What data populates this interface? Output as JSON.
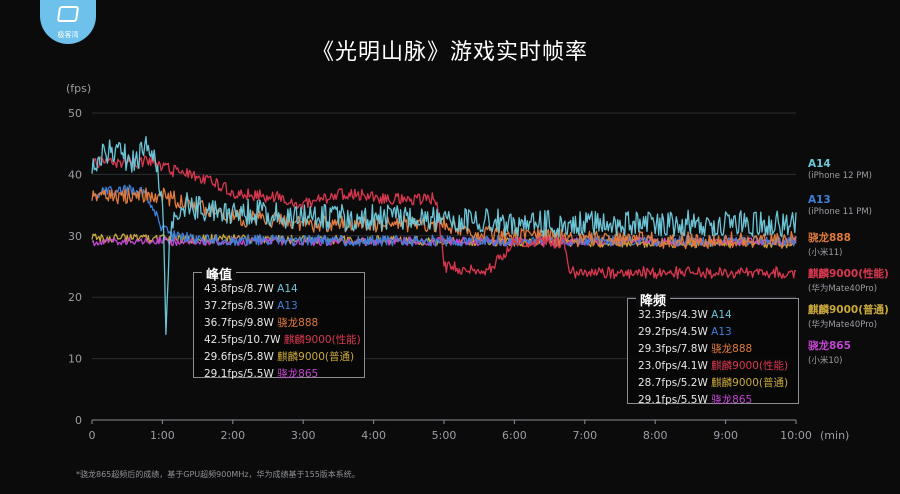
{
  "logo": {
    "text": "极客湾"
  },
  "title": "《光明山脉》游戏实时帧率",
  "chart_data": {
    "type": "line",
    "ylabel": "(fps)",
    "xunit": "(min)",
    "xlim": [
      0,
      10
    ],
    "ylim": [
      0,
      50
    ],
    "yticks": [
      0,
      10,
      20,
      30,
      40,
      50
    ],
    "xticks": [
      "0",
      "1:00",
      "2:00",
      "3:00",
      "4:00",
      "5:00",
      "6:00",
      "7:00",
      "8:00",
      "9:00",
      "10:00"
    ],
    "grid": true,
    "series": [
      {
        "name": "A14",
        "device": "(iPhone 12 PM)",
        "color": "#6cc5d6",
        "x": [
          0,
          0.3,
          0.6,
          0.85,
          1.0,
          1.05,
          1.1,
          1.3,
          2.0,
          3.0,
          4.0,
          5.0,
          6.0,
          7.0,
          8.0,
          9.0,
          10.0
        ],
        "values": [
          42,
          44,
          42,
          45,
          36,
          14,
          30,
          35,
          34,
          33,
          33,
          33,
          32,
          32,
          32,
          32,
          32
        ]
      },
      {
        "name": "A13",
        "device": "(iPhone 11 PM)",
        "color": "#3f7fd9",
        "x": [
          0,
          0.5,
          0.75,
          0.9,
          1.0,
          1.15,
          1.5,
          2.0,
          4.0,
          6.0,
          8.0,
          10.0
        ],
        "values": [
          37,
          37.5,
          37,
          34,
          31,
          30,
          29.5,
          29.3,
          29.2,
          29.2,
          29.2,
          29.2
        ]
      },
      {
        "name": "骁龙888",
        "device": "(小米11)",
        "color": "#e07a3d",
        "x": [
          0,
          1.0,
          1.5,
          2.0,
          3.0,
          4.0,
          5.0,
          5.5,
          6.0,
          7.0,
          8.0,
          9.0,
          10.0
        ],
        "values": [
          36.5,
          36.5,
          35,
          33,
          32,
          32,
          32,
          30.5,
          30,
          29.5,
          29.3,
          29.3,
          29.3
        ]
      },
      {
        "name": "麒麟9000(性能)",
        "device": "(华为Mate40Pro)",
        "color": "#d8384f",
        "x": [
          0,
          0.9,
          1.0,
          1.4,
          1.7,
          2.0,
          2.8,
          3.0,
          3.6,
          4.2,
          4.9,
          5.0,
          5.6,
          6.0,
          6.7,
          6.8,
          8.0,
          9.0,
          10.0
        ],
        "values": [
          42,
          42,
          41,
          40,
          39,
          37,
          36,
          35,
          37,
          36,
          36,
          25,
          24,
          29,
          29,
          24,
          24,
          24,
          24
        ]
      },
      {
        "name": "麒麟9000(普通)",
        "device": "(华为Mate40Pro)",
        "color": "#c9a83c",
        "x": [
          0,
          2.0,
          4.0,
          6.0,
          8.0,
          10.0
        ],
        "values": [
          29.6,
          29.5,
          29.3,
          29.0,
          28.8,
          28.7
        ]
      },
      {
        "name": "骁龙865",
        "device": "(小米10)",
        "color": "#c246d0",
        "x": [
          0,
          2.0,
          4.0,
          6.0,
          8.0,
          10.0
        ],
        "values": [
          29.1,
          29.1,
          29.1,
          29.1,
          29.1,
          29.1
        ]
      }
    ],
    "annotations": [
      {
        "title": "峰值",
        "rows": [
          {
            "value": "43.8fps/8.7W",
            "label": "A14",
            "color": "#6cc5d6"
          },
          {
            "value": "37.2fps/8.3W",
            "label": "A13",
            "color": "#3f7fd9"
          },
          {
            "value": "36.7fps/9.8W",
            "label": "骁龙888",
            "color": "#e07a3d"
          },
          {
            "value": "42.5fps/10.7W",
            "label": "麒麟9000(性能)",
            "color": "#d8384f"
          },
          {
            "value": "29.6fps/5.8W",
            "label": "麒麟9000(普通)",
            "color": "#c9a83c"
          },
          {
            "value": "29.1fps/5.5W",
            "label": "骁龙865",
            "color": "#c246d0"
          }
        ]
      },
      {
        "title": "降频",
        "rows": [
          {
            "value": "32.3fps/4.3W",
            "label": "A14",
            "color": "#6cc5d6"
          },
          {
            "value": "29.2fps/4.5W",
            "label": "A13",
            "color": "#3f7fd9"
          },
          {
            "value": "29.3fps/7.8W",
            "label": "骁龙888",
            "color": "#e07a3d"
          },
          {
            "value": "23.0fps/4.1W",
            "label": "麒麟9000(性能)",
            "color": "#d8384f"
          },
          {
            "value": "28.7fps/5.2W",
            "label": "麒麟9000(普通)",
            "color": "#c9a83c"
          },
          {
            "value": "29.1fps/5.5W",
            "label": "骁龙865",
            "color": "#c246d0"
          }
        ]
      }
    ]
  },
  "footnote": "*骁龙865超频后的成绩，基于GPU超频900MHz，华为成绩基于155版本系统。"
}
